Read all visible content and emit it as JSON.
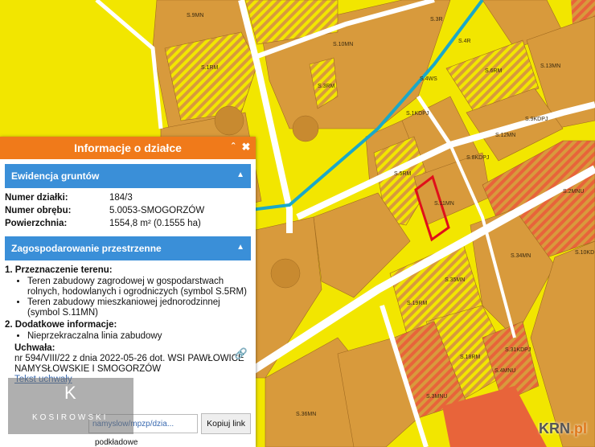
{
  "map": {
    "labels": [
      "S.9MN",
      "S.1RM",
      "S.10MN",
      "S.3R",
      "S.4R",
      "S.3RM",
      "S.4WS",
      "S.6RM",
      "S.13MN",
      "S.1KDPJ",
      "S.9KDPJ",
      "S.12MN",
      "S.8KDPJ",
      "S.5RM",
      "S.11MN",
      "S.2MNU",
      "S.34MN",
      "S.10KD",
      "S.35MN",
      "S.19RM",
      "S.18RM",
      "S.31KDPJ",
      "S.4MNU",
      "S.3MNU",
      "S.36MN"
    ],
    "colors": {
      "yellow": "#f2e600",
      "brown": "#d89a3c",
      "orange_hatch": "#e8643a",
      "road": "#ffffff",
      "water": "#1aa8c8",
      "parcel_outline": "#e0101a"
    }
  },
  "panel": {
    "title": "Informacje o działce",
    "ctrl_collapse": "ˆ",
    "ctrl_close": "✖",
    "section1": {
      "title": "Ewidencja gruntów",
      "rows": [
        {
          "key": "Numer działki:",
          "value": "184/3"
        },
        {
          "key": "Numer obrębu:",
          "value": "5.0053-SMOGORZÓW"
        },
        {
          "key": "Powierzchnia:",
          "value": "1554,8 m² (0.1555 ha)"
        }
      ]
    },
    "section2": {
      "title": "Zagospodarowanie przestrzenne",
      "item1_num": "1.",
      "item1_title": "Przeznaczenie terenu:",
      "item1_bullet1": "Teren zabudowy zagrodowej w gospodarstwach rolnych, hodowlanych i ogrodniczych (symbol S.5RM)",
      "item1_bullet2": "Teren zabudowy mieszkaniowej jednorodzinnej (symbol S.11MN)",
      "item2_num": "2.",
      "item2_title": "Dodatkowe informacje:",
      "item2_bullet1": "Nieprzekraczalna linia zabudowy",
      "uchwala_label": "Uchwała:",
      "uchwala_text": "nr 594/VIII/22 z dnia 2022-05-26 dot. WSI PAWŁOWICE NAMYSŁOWSKIE I SMOGORZÓW",
      "tekst_link": "Tekst uchwały",
      "bottom_text": "podkładowe"
    },
    "link_url": "namyslow/mpzp/dzia...",
    "copy_label": "Kopiuj link"
  },
  "watermark": {
    "brand": "KOSIROWSKI"
  },
  "krn": {
    "prefix": "KRN",
    "suffix": ".pl"
  }
}
